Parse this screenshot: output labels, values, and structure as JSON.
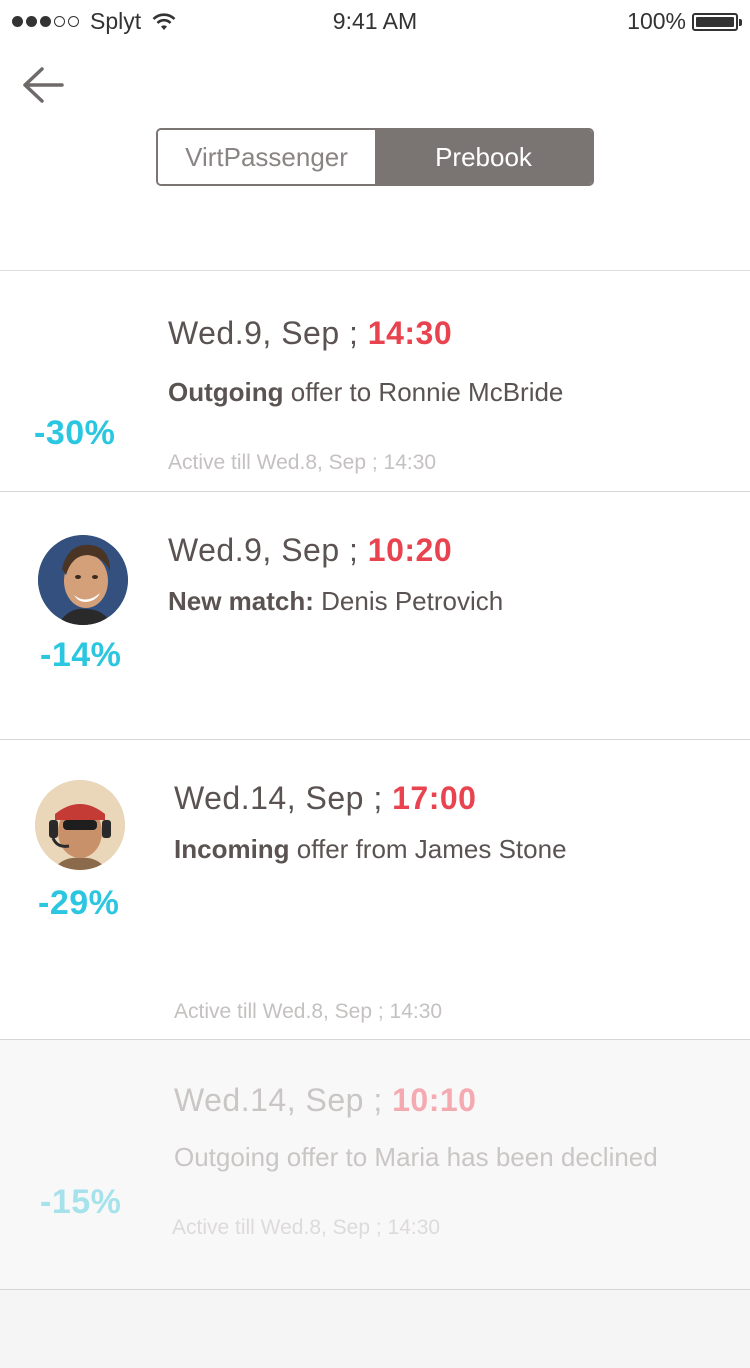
{
  "status_bar": {
    "carrier": "Splyt",
    "time": "9:41 AM",
    "battery": "100%"
  },
  "tabs": [
    {
      "label": "VirtPassenger",
      "active": false
    },
    {
      "label": "Prebook",
      "active": true
    }
  ],
  "items": [
    {
      "discount": "-30%",
      "date": "Wed.9, Sep ;",
      "time": "14:30",
      "desc_bold": "Outgoing",
      "desc_rest": " offer to Ronnie McBride",
      "active_till": "Active till Wed.8, Sep ; 14:30",
      "avatar": null
    },
    {
      "discount": "-14%",
      "date": "Wed.9, Sep ;",
      "time": "10:20",
      "desc_bold": "New match:",
      "desc_rest": " Denis Petrovich",
      "active_till": "",
      "avatar": "man-smiling-avatar"
    },
    {
      "discount": "-29%",
      "date": "Wed.14, Sep ;",
      "time": "17:00",
      "desc_bold": "Incoming",
      "desc_rest": " offer from James Stone",
      "active_till": "Active till Wed.8, Sep ; 14:30",
      "avatar": "man-headset-avatar"
    },
    {
      "discount": "-15%",
      "date": "Wed.14, Sep ;",
      "time": "10:10",
      "desc_bold": "",
      "desc_rest": "Outgoing offer to Maria has been declined",
      "active_till": "Active till Wed.8, Sep ; 14:30",
      "avatar": null
    }
  ],
  "colors": {
    "accent_time": "#e8434f",
    "discount": "#2bc6e0",
    "segment_active": "#7a7473"
  }
}
